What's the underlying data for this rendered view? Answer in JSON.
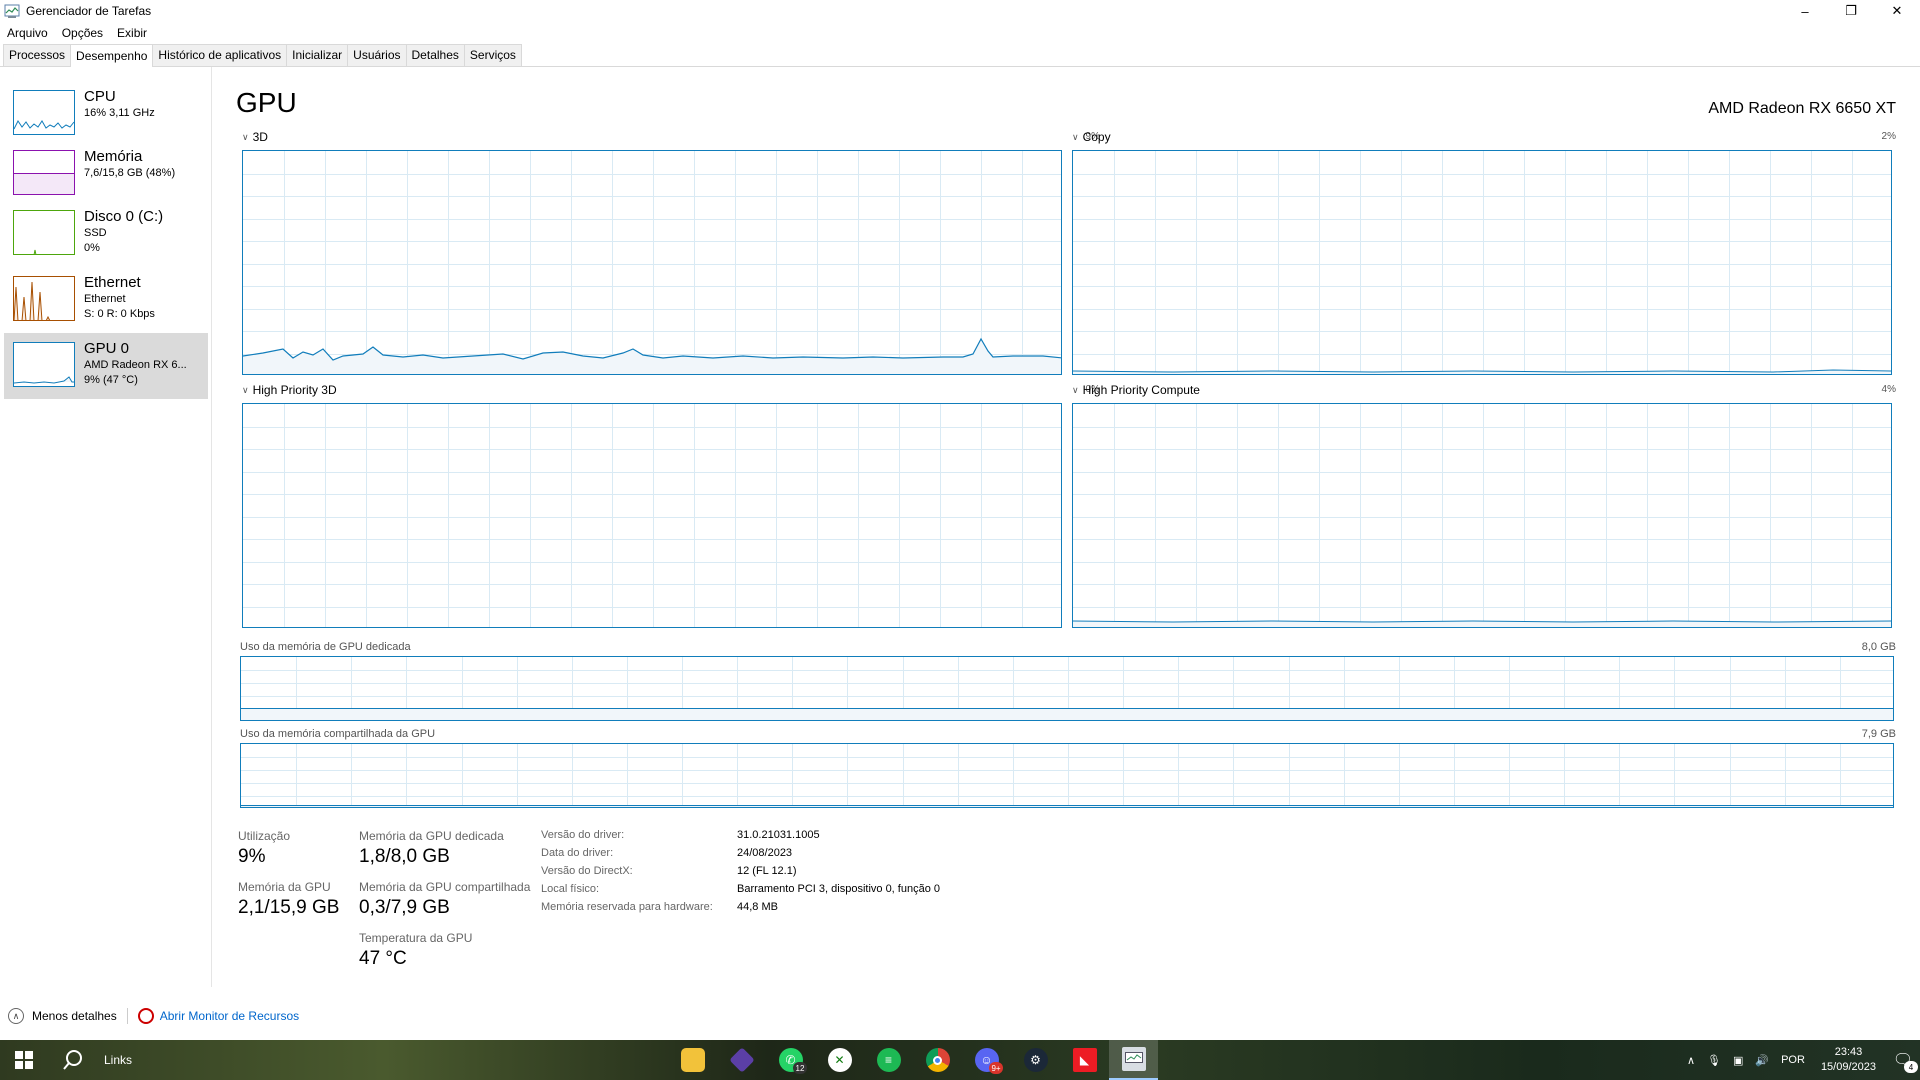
{
  "window": {
    "title": "Gerenciador de Tarefas"
  },
  "menu": [
    "Arquivo",
    "Opções",
    "Exibir"
  ],
  "tabs": [
    "Processos",
    "Desempenho",
    "Histórico de aplicativos",
    "Inicializar",
    "Usuários",
    "Detalhes",
    "Serviços"
  ],
  "sidebar": {
    "items": [
      {
        "title": "CPU",
        "line1": "16% 3,11 GHz",
        "line2": "",
        "line3": "",
        "color": "#117dbb"
      },
      {
        "title": "Memória",
        "line1": "7,6/15,8 GB (48%)",
        "line2": "",
        "line3": "",
        "color": "#8b12ae"
      },
      {
        "title": "Disco 0 (C:)",
        "line1": "SSD",
        "line2": "0%",
        "line3": "",
        "color": "#4da60c"
      },
      {
        "title": "Ethernet",
        "line1": "Ethernet",
        "line2": "S: 0 R: 0 Kbps",
        "line3": "",
        "color": "#a74f01"
      },
      {
        "title": "GPU 0",
        "line1": "AMD Radeon RX 6...",
        "line2": "9% (47 °C)",
        "line3": "",
        "color": "#117dbb"
      }
    ]
  },
  "main": {
    "title": "GPU",
    "gpu_name": "AMD Radeon RX 6650 XT",
    "graphs": [
      {
        "label": "3D",
        "pct": "9%"
      },
      {
        "label": "Copy",
        "pct": "2%"
      },
      {
        "label": "High Priority 3D",
        "pct": "0%"
      },
      {
        "label": "High Priority Compute",
        "pct": "4%"
      }
    ],
    "mem_dedicated": {
      "label": "Uso da memória de GPU dedicada",
      "max": "8,0 GB"
    },
    "mem_shared": {
      "label": "Uso da memória compartilhada da GPU",
      "max": "7,9 GB"
    }
  },
  "stats": {
    "utilization_label": "Utilização",
    "utilization": "9%",
    "gpu_mem_label": "Memória da GPU",
    "gpu_mem": "2,1/15,9 GB",
    "dedicated_label": "Memória da GPU dedicada",
    "dedicated": "1,8/8,0 GB",
    "shared_label": "Memória da GPU compartilhada",
    "shared": "0,3/7,9 GB",
    "temp_label": "Temperatura da GPU",
    "temp": "47 °C"
  },
  "info": {
    "driver_version_label": "Versão do driver:",
    "driver_version": "31.0.21031.1005",
    "driver_date_label": "Data do driver:",
    "driver_date": "24/08/2023",
    "directx_label": "Versão do DirectX:",
    "directx": "12 (FL 12.1)",
    "location_label": "Local físico:",
    "location": "Barramento PCI 3, dispositivo 0, função 0",
    "reserved_label": "Memória reservada para hardware:",
    "reserved": "44,8 MB"
  },
  "footer": {
    "less_details": "Menos detalhes",
    "resource_monitor": "Abrir Monitor de Recursos"
  },
  "taskbar": {
    "search": "Links",
    "whatsapp_badge": "12",
    "discord_badge": "9+",
    "tray_lang": "POR",
    "time": "23:43",
    "date": "15/09/2023",
    "notifications": "4"
  },
  "colors": {
    "gpu_line": "#117dbb",
    "gpu_fill": "#f1f6fa",
    "grid": "#d9eaf4",
    "link": "#0066cc"
  }
}
